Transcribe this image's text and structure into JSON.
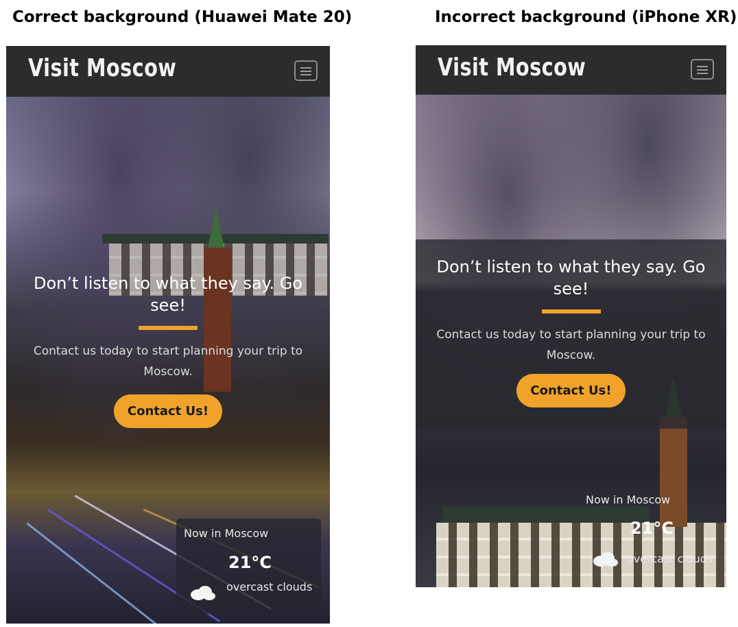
{
  "captions": {
    "left": "Correct background (Huawei Mate 20)",
    "right": "Incorrect background (iPhone XR)"
  },
  "site": {
    "brand": "Visit Moscow",
    "menu_icon": "hamburger-menu-icon",
    "hero": {
      "title": "Don’t listen to what they say. Go see!",
      "subtitle": "Contact us today to start planning your trip to Moscow.",
      "cta_label": "Contact Us!"
    },
    "weather": {
      "title": "Now in Moscow",
      "temperature": "21°C",
      "description": "overcast clouds",
      "icon": "cloud-icon"
    }
  },
  "colors": {
    "navbar": "#2c2c2e",
    "accent": "#f0a22b",
    "text_light": "#ffffff"
  }
}
